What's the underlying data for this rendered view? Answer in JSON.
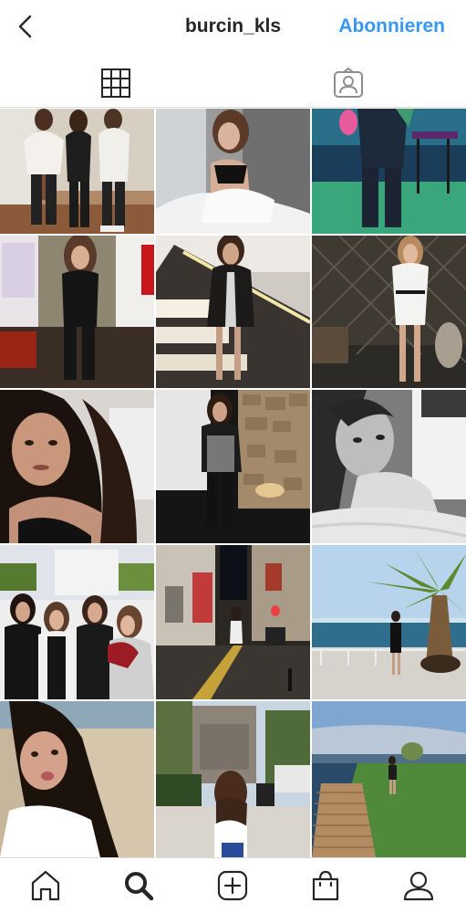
{
  "header": {
    "username": "burcin_kls",
    "follow_label": "Abonnieren",
    "accent_color": "#3897f0"
  },
  "tabs": [
    {
      "icon": "grid-icon",
      "active": true
    },
    {
      "icon": "tagged-person-icon",
      "active": false
    }
  ],
  "photos": [
    {
      "desc": "three women posing indoors"
    },
    {
      "desc": "woman sitting on white bed"
    },
    {
      "desc": "woman in club with neon lighting"
    },
    {
      "desc": "woman in black outfit by stone wall"
    },
    {
      "desc": "woman on illuminated staircase"
    },
    {
      "desc": "woman in white dress on terrace at night"
    },
    {
      "desc": "close-up selfie with long dark hair"
    },
    {
      "desc": "woman in black dress by stone wall at night"
    },
    {
      "desc": "black and white portrait"
    },
    {
      "desc": "group of four women outdoors"
    },
    {
      "desc": "woman on street at night"
    },
    {
      "desc": "woman under palm tree by sea"
    },
    {
      "desc": "selfie on beach"
    },
    {
      "desc": "woman walking near monument"
    },
    {
      "desc": "woman on grass by lake with pier"
    }
  ],
  "bottom_nav": [
    {
      "icon": "home-icon"
    },
    {
      "icon": "search-icon",
      "active": true
    },
    {
      "icon": "add-post-icon"
    },
    {
      "icon": "shop-bag-icon"
    },
    {
      "icon": "profile-icon"
    }
  ]
}
